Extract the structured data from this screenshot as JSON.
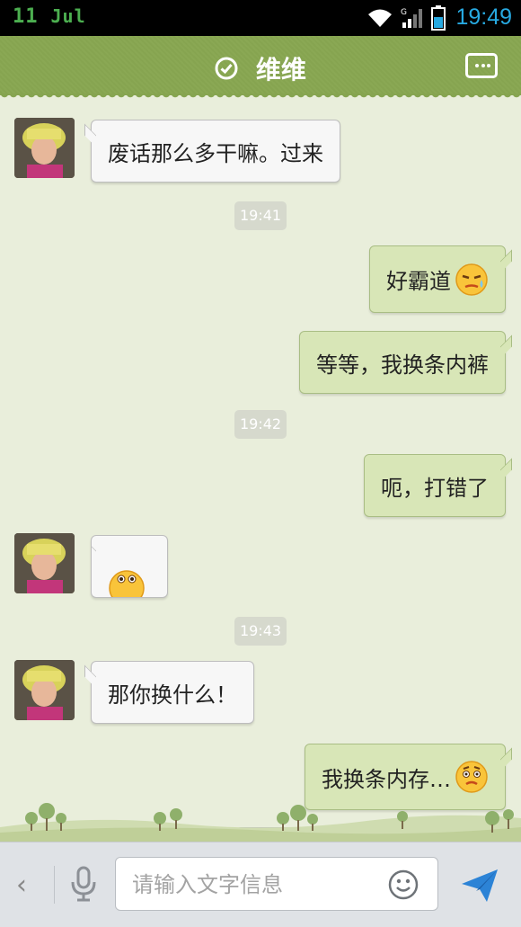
{
  "status_bar": {
    "day": "11",
    "month": "Jul",
    "time": "19:49"
  },
  "header": {
    "title": "维维",
    "verified_icon": "check-circle-icon",
    "menu_icon": "more-dots-icon"
  },
  "messages": [
    {
      "side": "in",
      "text": "废话那么多干嘛。过来"
    },
    {
      "timestamp": "19:41"
    },
    {
      "side": "out",
      "text": "好霸道",
      "emoji": "sweat-face-emoji"
    },
    {
      "side": "out",
      "text": "等等，我换条内裤"
    },
    {
      "timestamp": "19:42"
    },
    {
      "side": "out",
      "text": "呃，打错了"
    },
    {
      "side": "in",
      "emoji": "peek-face-emoji"
    },
    {
      "timestamp": "19:43"
    },
    {
      "side": "in",
      "text": "那你换什么！"
    },
    {
      "side": "out",
      "text": "我换条内存…",
      "emoji": "awkward-face-emoji"
    }
  ],
  "input_bar": {
    "back_icon": "chevron-left-icon",
    "mic_icon": "microphone-icon",
    "placeholder": "请输入文字信息",
    "smiley_icon": "smiley-icon",
    "send_icon": "send-icon"
  },
  "colors": {
    "header": "#86a450",
    "background": "#e9eedb",
    "outgoing_bubble": "#d8e6b7",
    "incoming_bubble": "#f7f7f7",
    "clock": "#27a9e1"
  }
}
